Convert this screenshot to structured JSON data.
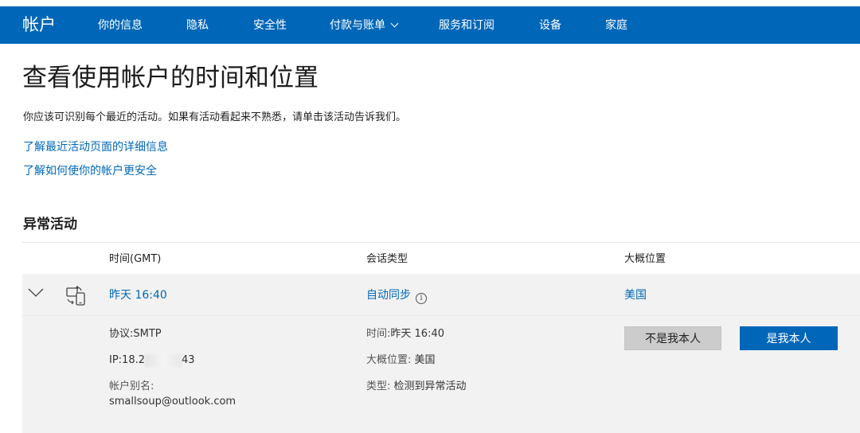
{
  "header": {
    "brand": "帐户",
    "nav": [
      {
        "label": "你的信息",
        "name": "nav-your-info"
      },
      {
        "label": "隐私",
        "name": "nav-privacy"
      },
      {
        "label": "安全性",
        "name": "nav-security"
      },
      {
        "label": "付款与账单",
        "name": "nav-payment-billing",
        "has_dropdown": true
      },
      {
        "label": "服务和订阅",
        "name": "nav-services-subscriptions"
      },
      {
        "label": "设备",
        "name": "nav-devices"
      },
      {
        "label": "家庭",
        "name": "nav-family"
      }
    ]
  },
  "page": {
    "title": "查看使用帐户的时间和位置",
    "intro": "你应该可识别每个最近的活动。如果有活动看起来不熟悉，请单击该活动告诉我们。",
    "links": [
      "了解最近活动页面的详细信息",
      "了解如何使你的帐户更安全"
    ],
    "section_title": "异常活动"
  },
  "table": {
    "headers": {
      "time": "时间(GMT)",
      "session_type": "会话类型",
      "location": "大概位置"
    },
    "row": {
      "time": "昨天 16:40",
      "session_type": "自动同步",
      "location": "美国",
      "icons": {
        "expand": "chevron-down-icon",
        "device": "sync-devices-icon",
        "info": "info-icon"
      }
    },
    "details": {
      "protocol": "协议:SMTP",
      "ip_prefix": "IP:18.2",
      "ip_suffix": "43",
      "alias_label": "帐户别名:",
      "alias_value": "smallsoup@outlook.com",
      "time_label": "时间:",
      "time_value": "昨天 16:40",
      "location_label": "大概位置: ",
      "location_value": "美国",
      "type_label": "类型: ",
      "type_value": "检测到异常活动"
    },
    "actions": {
      "not_me": "不是我本人",
      "is_me": "是我本人"
    }
  },
  "colors": {
    "brand_blue": "#0067b8",
    "row_bg": "#f2f2f2",
    "secondary_button": "#cccccc"
  }
}
